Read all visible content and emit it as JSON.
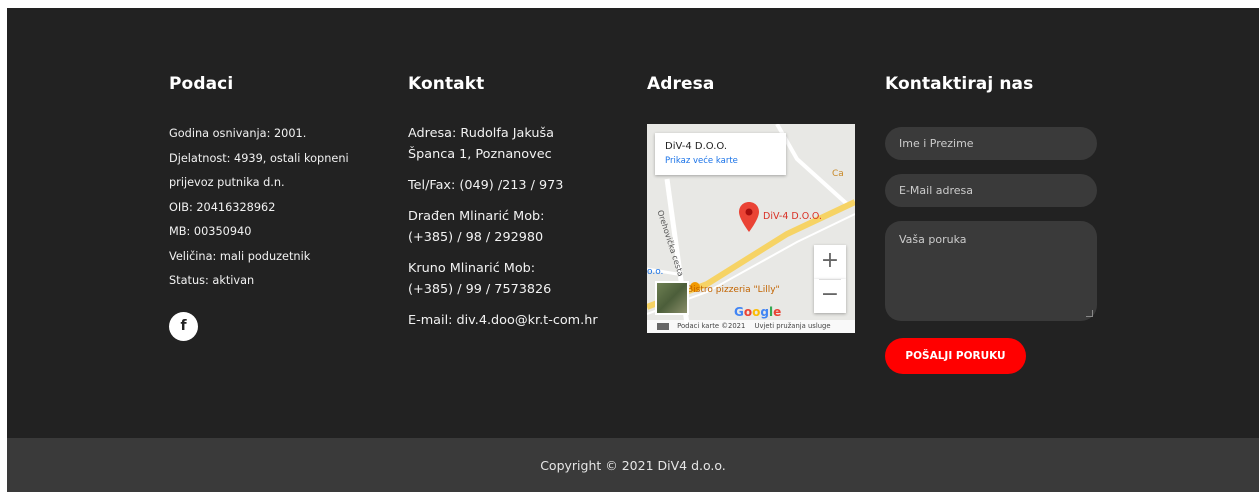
{
  "podaci": {
    "title": "Podaci",
    "lines": [
      "Godina osnivanja: 2001.",
      "Djelatnost: 4939, ostali kopneni",
      "prijevoz putnika d.n.",
      "OIB: 20416328962",
      "MB: 00350940",
      "Veličina: mali poduzetnik",
      "Status: aktivan"
    ],
    "facebook_icon": "f"
  },
  "kontakt": {
    "title": "Kontakt",
    "address_1": "Adresa: Rudolfa Jakuša",
    "address_2": "Španca 1, Poznanovec",
    "telfax": "Tel/Fax: (049) /213 / 973",
    "person1_1": "Drađen Mlinarić Mob:",
    "person1_2": "(+385) / 98 / 292980",
    "person2_1": "Kruno Mlinarić Mob:",
    "person2_2": "(+385) / 99 / 7573826",
    "email": "E-mail: div.4.doo@kr.t-com.hr"
  },
  "adresa": {
    "title": "Adresa",
    "map": {
      "place_name": "DiV-4 D.O.O.",
      "link_label": "Prikaz veće karte",
      "pin_label": "DiV-4 D.O.O.",
      "road_label": "Orehovička cesta",
      "poi_label": "Bistro pizzeria \"Lilly\"",
      "edge_label": "Ca",
      "edge_label_left": "o.o.",
      "google_logo": "Google",
      "zoom_in": "+",
      "zoom_out": "−",
      "footer_data": "Podaci karte ©2021",
      "footer_terms": "Uvjeti pružanja usluge"
    }
  },
  "form": {
    "title": "Kontaktiraj nas",
    "name_placeholder": "Ime i Prezime",
    "email_placeholder": "E-Mail adresa",
    "message_placeholder": "Vaša poruka",
    "submit_label": "POŠALJI PORUKU"
  },
  "footer": {
    "copyright": "Copyright © 2021 DiV4 d.o.o."
  },
  "colors": {
    "footer_bg": "#222222",
    "bottom_bar_bg": "#3a3a3a",
    "field_bg": "#3a3a3a",
    "button_red": "#ff0000",
    "map_road_yellow": "#f6d365",
    "pin_red": "#ea4335"
  }
}
